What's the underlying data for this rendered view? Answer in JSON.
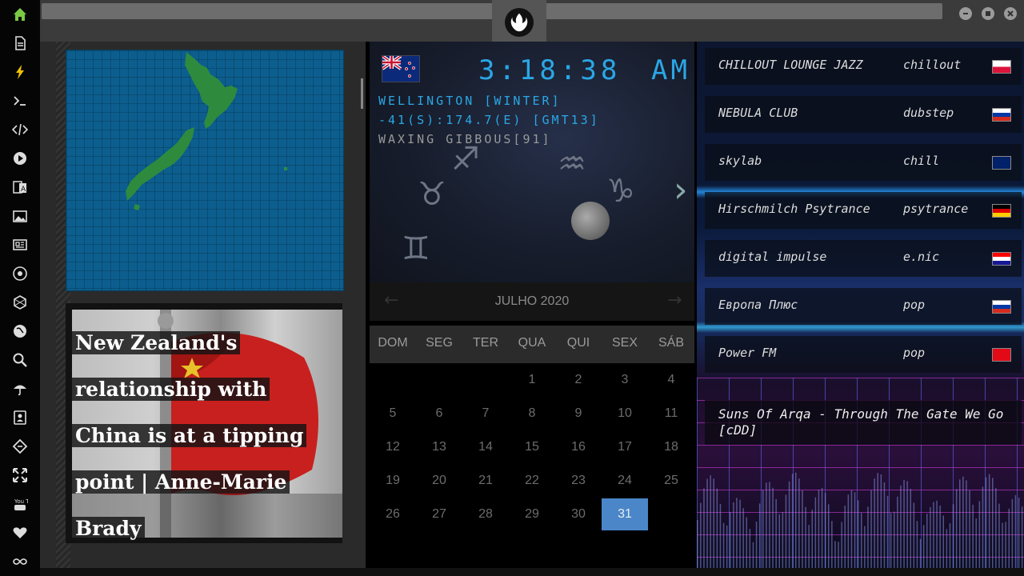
{
  "sidebar": {
    "icons": [
      "home-icon",
      "document-icon",
      "lightning-icon",
      "terminal-icon",
      "code-icon",
      "play-icon",
      "translate-icon",
      "image-icon",
      "newspaper-icon",
      "rebel-alliance-icon",
      "hexagon-icon",
      "globe-icon",
      "search-icon",
      "umbrella-icon",
      "contact-card-icon",
      "tag-icon",
      "expand-icon",
      "youtube-icon",
      "heart-icon",
      "infinity-icon"
    ],
    "youtube_label": "You Tube"
  },
  "colors": {
    "accent": "#2aa7e6",
    "today": "#4a86c8",
    "sidebar_active": "#7ac943"
  },
  "news": {
    "headline_lines": [
      "New Zealand's",
      "relationship with",
      "China is at a tipping",
      "point | Anne-Marie",
      "Brady"
    ]
  },
  "clock": {
    "time": "3:18:38",
    "ampm": "AM",
    "location": "WELLINGTON [WINTER]",
    "coords": "-41(S):174.7(E) [GMT13]",
    "moon": "WAXING GIBBOUS[91]"
  },
  "calendar": {
    "title": "JULHO 2020",
    "prev": "←",
    "next": "→",
    "weekdays": [
      "DOM",
      "SEG",
      "TER",
      "QUA",
      "QUI",
      "SEX",
      "SÁB"
    ],
    "days": [
      "1",
      "2",
      "3",
      "4",
      "5",
      "6",
      "7",
      "8",
      "9",
      "10",
      "11",
      "12",
      "13",
      "14",
      "15",
      "16",
      "17",
      "18",
      "19",
      "20",
      "21",
      "22",
      "23",
      "24",
      "25",
      "26",
      "27",
      "28",
      "29",
      "30",
      "31"
    ],
    "first_weekday": 3,
    "today": "31"
  },
  "radio": {
    "stations": [
      {
        "name": "CHILLOUT LOUNGE JAZZ",
        "genre": "chillout",
        "country": "pl"
      },
      {
        "name": "NEBULA CLUB",
        "genre": "dubstep",
        "country": "ru"
      },
      {
        "name": "skylab",
        "genre": "chill",
        "country": "gb"
      },
      {
        "name": "Hirschmilch Psytrance",
        "genre": "psytrance",
        "country": "de"
      },
      {
        "name": "digital impulse",
        "genre": "e.nic",
        "country": "hr"
      },
      {
        "name": "Европа Плюс",
        "genre": "pop",
        "country": "ru"
      },
      {
        "name": "Power FM",
        "genre": "pop",
        "country": "tr"
      }
    ],
    "now_playing": "Suns Of Arqa - Through The Gate We Go [cDD]"
  }
}
